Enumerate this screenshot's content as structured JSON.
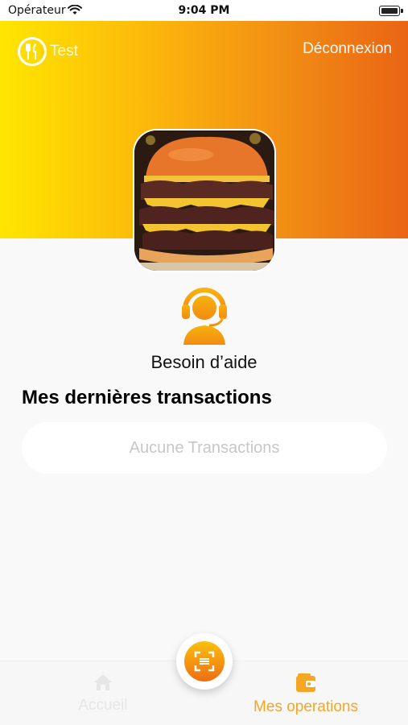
{
  "status_bar": {
    "carrier": "Opérateur",
    "time": "9:04 PM"
  },
  "header": {
    "brand_name": "Test",
    "logout_label": "Déconnexion"
  },
  "support": {
    "label": "Besoin d’aide"
  },
  "transactions": {
    "title": "Mes dernières transactions",
    "empty_message": "Aucune Transactions"
  },
  "tabbar": {
    "home_label": "Accueil",
    "operations_label": "Mes operations"
  },
  "colors": {
    "gradient_start": "#ffe600",
    "gradient_end": "#ea6414",
    "accent": "#f5a623"
  }
}
